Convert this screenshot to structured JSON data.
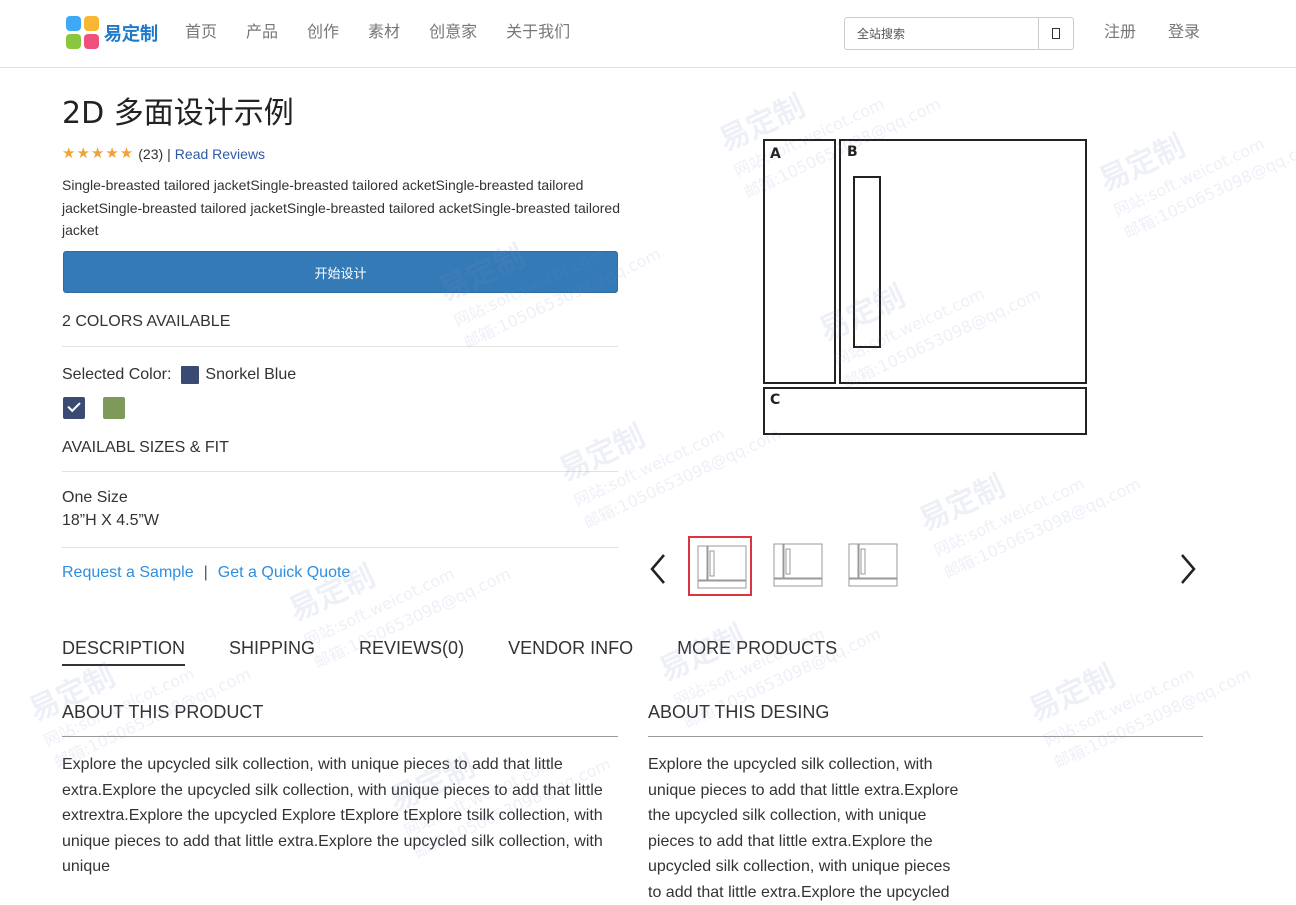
{
  "header": {
    "logo_text": "易定制",
    "nav": [
      "首页",
      "产品",
      "创作",
      "素材",
      "创意家",
      "关于我们"
    ],
    "search_placeholder": "全站搜索",
    "register": "注册",
    "login": "登录"
  },
  "product": {
    "title": "2D 多面设计示例",
    "rating_stars": "★★★★★",
    "rating_value": 5,
    "rating_count": "(23)",
    "rating_sep": "|",
    "read_reviews": "Read Reviews",
    "description": "Single-breasted tailored jacketSingle-breasted tailored acketSingle-breasted tailored jacketSingle-breasted tailored jacketSingle-breasted tailored acketSingle-breasted tailored jacket",
    "start_button": "开始设计",
    "colors_available": "2 COLORS AVAILABLE",
    "selected_color_label": "Selected Color:",
    "selected_color_name": "Snorkel Blue",
    "colors": [
      "#3a4a72",
      "#7d9a5a"
    ],
    "sizes_label": "AVAILABL SIZES & FIT",
    "size_name": "One Size",
    "size_dims": "18”H X 4.5”W",
    "request_sample": "Request a Sample",
    "link_sep": "|",
    "quick_quote": "Get a Quick Quote"
  },
  "diagram": {
    "panel_labels": [
      "A",
      "B",
      "C"
    ]
  },
  "tabs": [
    "DESCRIPTION",
    "SHIPPING",
    "REVIEWS(0)",
    "VENDOR INFO",
    "MORE PRODUCTS"
  ],
  "about_product": {
    "title": "ABOUT THIS PRODUCT",
    "text": "Explore the upcycled silk collection, with unique pieces to add that little extra.Explore the upcycled silk collection, with unique pieces to add that little extrextra.Explore the upcycled Explore tExplore tExplore tsilk collection, with unique pieces to add that little extra.Explore the upcycled silk collection, with unique"
  },
  "about_design": {
    "title": "ABOUT THIS DESING",
    "text": "Explore the upcycled silk collection, with unique pieces to add that little extra.Explore the upcycled silk collection, with unique pieces to add that little extra.Explore the upcycled silk collection, with unique pieces to add that little extra.Explore the upcycled"
  },
  "watermark": {
    "brand": "易定制",
    "site": "网站:soft.weicot.com",
    "mail": "邮箱:1050653098@qq.com"
  }
}
